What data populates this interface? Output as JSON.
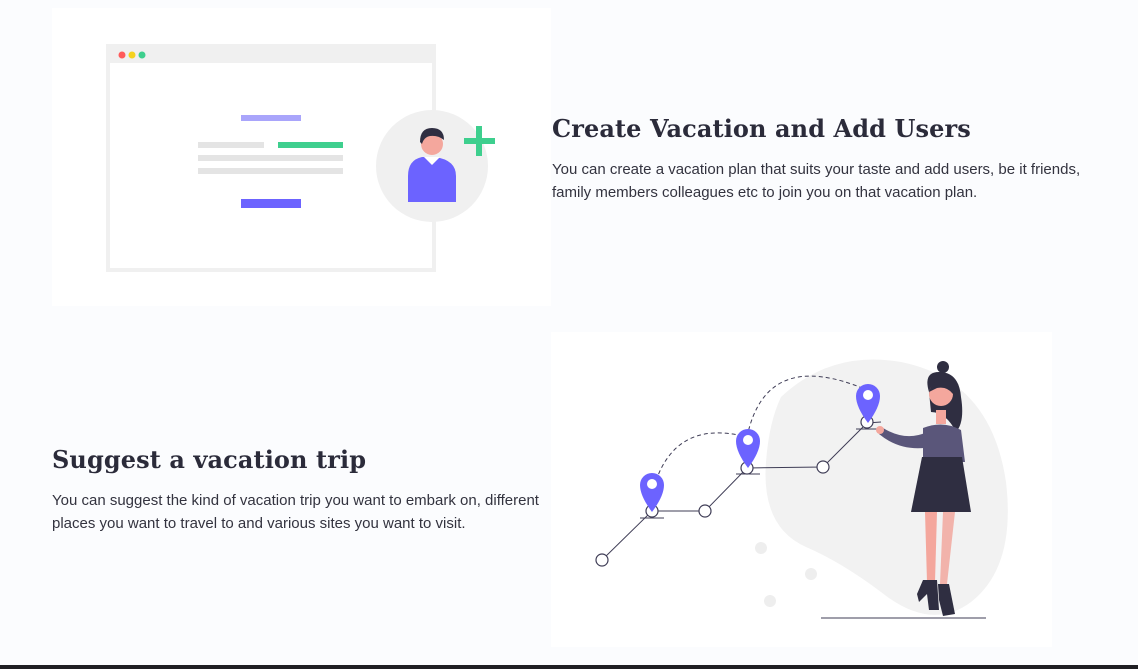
{
  "features": [
    {
      "title": "Create Vacation and Add Users",
      "description": "You can create a vacation plan that suits your taste and add users, be it friends, family members colleagues etc to join you on that vacation plan.",
      "illustration": "add-user-illustration"
    },
    {
      "title": "Suggest a vacation trip",
      "description": "You can suggest the kind of vacation trip you want to embark on, different places you want to travel to and various sites you want to visit.",
      "illustration": "travel-route-illustration"
    }
  ],
  "colors": {
    "accent": "#6c63ff",
    "accent_light": "#a9a5fb",
    "green": "#3ecf8e",
    "skin": "#f4a79d",
    "dark": "#2f2e41",
    "blob": "#f2f2f2",
    "page_bg": "#fbfcfe"
  }
}
